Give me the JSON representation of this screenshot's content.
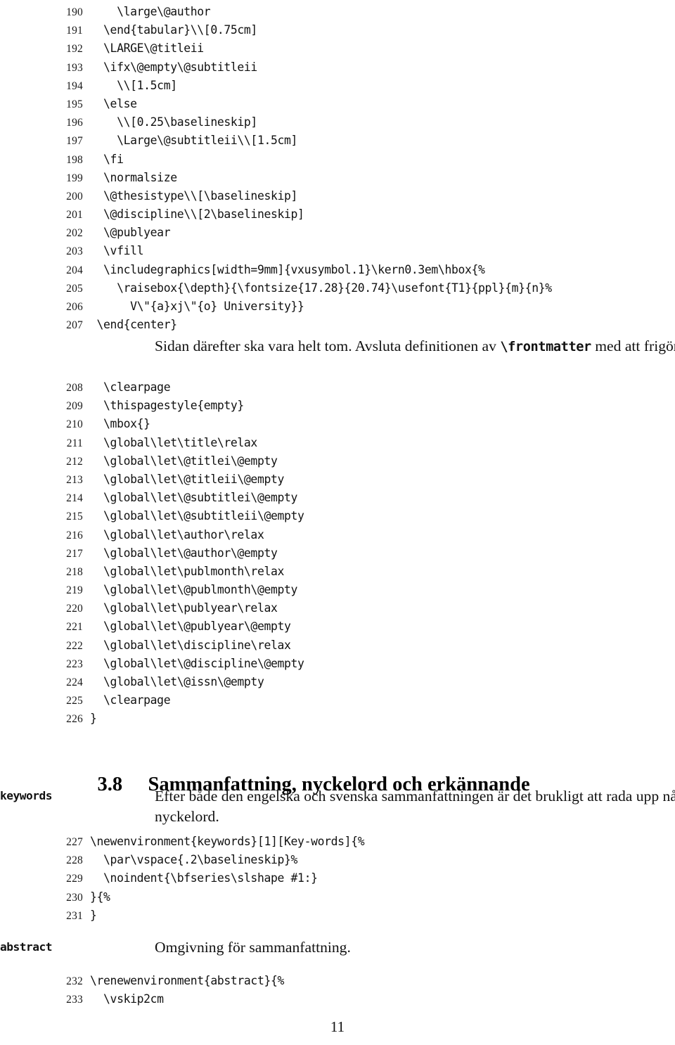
{
  "document": {
    "page_number": "11",
    "language": "sv"
  },
  "listing_one": {
    "lines": [
      {
        "no": "190",
        "code": "    \\large\\@author"
      },
      {
        "no": "191",
        "code": "  \\end{tabular}\\\\[0.75cm]"
      },
      {
        "no": "192",
        "code": "  \\LARGE\\@titleii"
      },
      {
        "no": "193",
        "code": "  \\ifx\\@empty\\@subtitleii"
      },
      {
        "no": "194",
        "code": "    \\\\[1.5cm]"
      },
      {
        "no": "195",
        "code": "  \\else"
      },
      {
        "no": "196",
        "code": "    \\\\[0.25\\baselineskip]"
      },
      {
        "no": "197",
        "code": "    \\Large\\@subtitleii\\\\[1.5cm]"
      },
      {
        "no": "198",
        "code": "  \\fi"
      },
      {
        "no": "199",
        "code": "  \\normalsize"
      },
      {
        "no": "200",
        "code": "  \\@thesistype\\\\[\\baselineskip]"
      },
      {
        "no": "201",
        "code": "  \\@discipline\\\\[2\\baselineskip]"
      },
      {
        "no": "202",
        "code": "  \\@publyear"
      },
      {
        "no": "203",
        "code": "  \\vfill"
      },
      {
        "no": "204",
        "code": "  \\includegraphics[width=9mm]{vxusymbol.1}\\kern0.3em\\hbox{%"
      },
      {
        "no": "205",
        "code": "    \\raisebox{\\depth}{\\fontsize{17.28}{20.74}\\usefont{T1}{ppl}{m}{n}%"
      },
      {
        "no": "206",
        "code": "      V\\\"{a}xj\\\"{o} University}}"
      },
      {
        "no": "207",
        "code": " \\end{center}"
      }
    ]
  },
  "paragraph_one": {
    "part1": "Sidan därefter ska vara helt tom. Avsluta definitionen av ",
    "code": "\\frontmatter",
    "part2": " med att frigöra minne."
  },
  "listing_two": {
    "lines": [
      {
        "no": "208",
        "code": "  \\clearpage"
      },
      {
        "no": "209",
        "code": "  \\thispagestyle{empty}"
      },
      {
        "no": "210",
        "code": "  \\mbox{}"
      },
      {
        "no": "211",
        "code": "  \\global\\let\\title\\relax"
      },
      {
        "no": "212",
        "code": "  \\global\\let\\@titlei\\@empty"
      },
      {
        "no": "213",
        "code": "  \\global\\let\\@titleii\\@empty"
      },
      {
        "no": "214",
        "code": "  \\global\\let\\@subtitlei\\@empty"
      },
      {
        "no": "215",
        "code": "  \\global\\let\\@subtitleii\\@empty"
      },
      {
        "no": "216",
        "code": "  \\global\\let\\author\\relax"
      },
      {
        "no": "217",
        "code": "  \\global\\let\\@author\\@empty"
      },
      {
        "no": "218",
        "code": "  \\global\\let\\publmonth\\relax"
      },
      {
        "no": "219",
        "code": "  \\global\\let\\@publmonth\\@empty"
      },
      {
        "no": "220",
        "code": "  \\global\\let\\publyear\\relax"
      },
      {
        "no": "221",
        "code": "  \\global\\let\\@publyear\\@empty"
      },
      {
        "no": "222",
        "code": "  \\global\\let\\discipline\\relax"
      },
      {
        "no": "223",
        "code": "  \\global\\let\\@discipline\\@empty"
      },
      {
        "no": "224",
        "code": "  \\global\\let\\@issn\\@empty"
      },
      {
        "no": "225",
        "code": "  \\clearpage"
      },
      {
        "no": "226",
        "code": "}"
      }
    ]
  },
  "section": {
    "number": "3.8",
    "title": "Sammanfattning, nyckelord och erkännande"
  },
  "keywords_block": {
    "margin_label": "keywords",
    "paragraph": "Efter både den engelska och svenska sammanfattningen är det brukligt att rada upp några nyckelord.",
    "lines": [
      {
        "no": "227",
        "code": "\\newenvironment{keywords}[1][Key-words]{%"
      },
      {
        "no": "228",
        "code": "  \\par\\vspace{.2\\baselineskip}%"
      },
      {
        "no": "229",
        "code": "  \\noindent{\\bfseries\\slshape #1:}"
      },
      {
        "no": "230",
        "code": "}{%"
      },
      {
        "no": "231",
        "code": "}"
      }
    ]
  },
  "abstract_block": {
    "margin_label": "abstract",
    "paragraph": "Omgivning för sammanfattning.",
    "lines": [
      {
        "no": "232",
        "code": "\\renewenvironment{abstract}{%"
      },
      {
        "no": "233",
        "code": "  \\vskip2cm"
      }
    ]
  }
}
